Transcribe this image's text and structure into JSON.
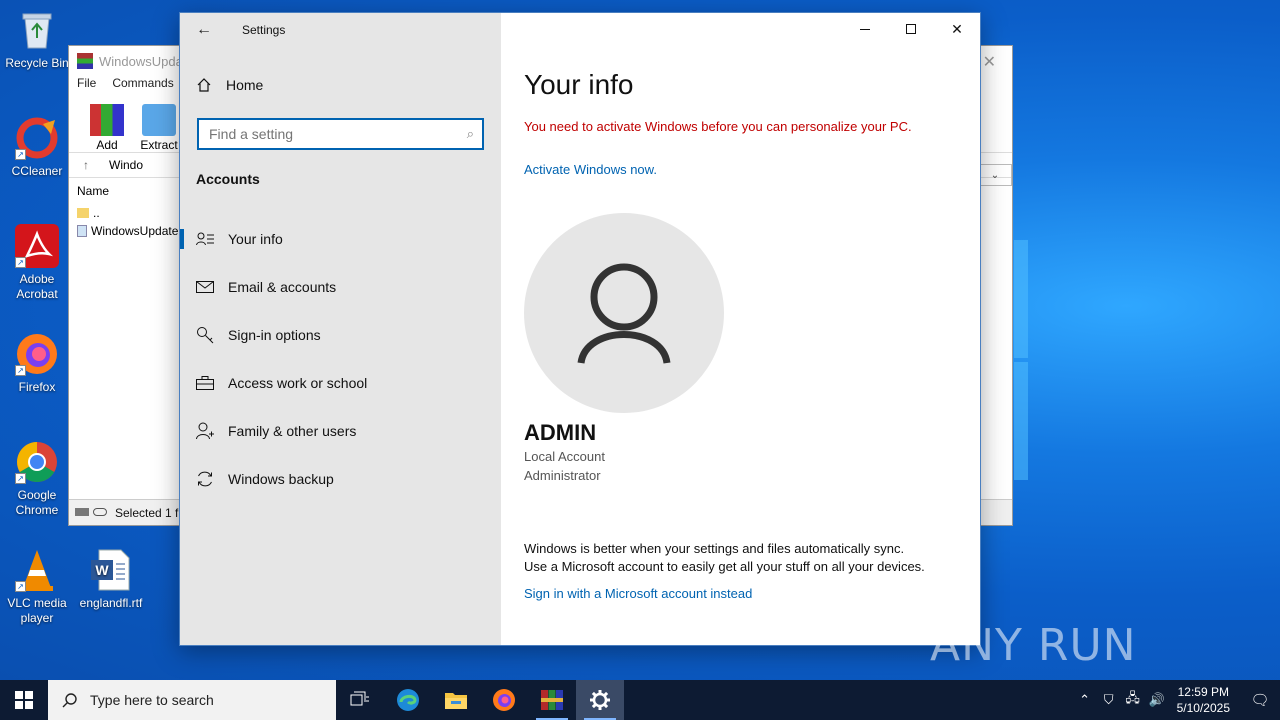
{
  "desktop_icons": [
    {
      "label": "Recycle Bin",
      "icon": "recycle-bin-icon"
    },
    {
      "label": "CCleaner",
      "icon": "ccleaner-icon"
    },
    {
      "label": "Adobe Acrobat",
      "icon": "adobe-acrobat-icon"
    },
    {
      "label": "Firefox",
      "icon": "firefox-icon"
    },
    {
      "label": "Google Chrome",
      "icon": "chrome-icon"
    },
    {
      "label": "VLC media player",
      "icon": "vlc-icon"
    },
    {
      "label": "englandfl.rtf",
      "icon": "word-document-icon"
    }
  ],
  "winrar": {
    "title": "WindowsUpdat",
    "menu": [
      "File",
      "Commands"
    ],
    "toolbar": [
      "Add",
      "Extract"
    ],
    "address": "Windo",
    "column_name": "Name",
    "files": [
      "..",
      "WindowsUpdate"
    ],
    "status": "Selected 1 fi"
  },
  "settings": {
    "app_title": "Settings",
    "home_label": "Home",
    "search_placeholder": "Find a setting",
    "section_label": "Accounts",
    "nav_items": [
      {
        "label": "Your info",
        "icon": "contact-info-icon",
        "active": true
      },
      {
        "label": "Email & accounts",
        "icon": "mail-icon",
        "active": false
      },
      {
        "label": "Sign-in options",
        "icon": "key-icon",
        "active": false
      },
      {
        "label": "Access work or school",
        "icon": "briefcase-icon",
        "active": false
      },
      {
        "label": "Family & other users",
        "icon": "person-add-icon",
        "active": false
      },
      {
        "label": "Windows backup",
        "icon": "sync-icon",
        "active": false
      }
    ],
    "content": {
      "title": "Your info",
      "activation_warning": "You need to activate Windows before you can personalize your PC.",
      "activate_link": "Activate Windows now.",
      "username": "ADMIN",
      "account_type": "Local Account",
      "account_role": "Administrator",
      "sync_line1": "Windows is better when your settings and files automatically sync.",
      "sync_line2": "Use a Microsoft account to easily get all your stuff on all your devices.",
      "ms_account_link": "Sign in with a Microsoft account instead"
    }
  },
  "watermark": "ANY RUN",
  "taskbar": {
    "search_placeholder": "Type here to search",
    "pinned": [
      "task-view-icon",
      "edge-icon",
      "file-explorer-icon",
      "firefox-icon",
      "winrar-icon",
      "settings-gear-icon"
    ],
    "time": "12:59 PM",
    "date": "5/10/2025"
  },
  "colors": {
    "accent": "#0063b1",
    "warning": "#c00000",
    "taskbar": "#0d1b33"
  }
}
